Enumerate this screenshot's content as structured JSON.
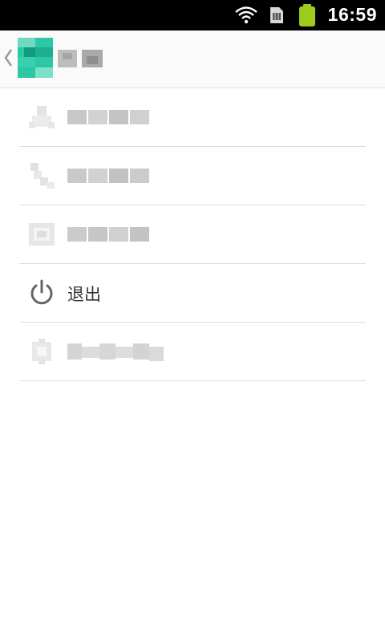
{
  "status_bar": {
    "time": "16:59",
    "icons": [
      "wifi-icon",
      "sim-card-icon",
      "battery-icon"
    ],
    "battery_color": "#9ccc1c"
  },
  "action_bar": {
    "back_icon": "chevron-left-icon",
    "app_icon_color": "#2cc7a4",
    "title": ""
  },
  "menu": {
    "items": [
      {
        "icon": "user-icon",
        "label": ""
      },
      {
        "icon": "phone-icon",
        "label": ""
      },
      {
        "icon": "message-icon",
        "label": ""
      },
      {
        "icon": "power-icon",
        "label": "退出"
      },
      {
        "icon": "gear-icon",
        "label": ""
      }
    ]
  }
}
